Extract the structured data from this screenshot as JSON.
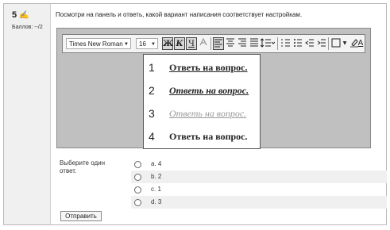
{
  "question": {
    "number": "5",
    "flag_glyph": "✍",
    "grade": "Баллов: --/2",
    "text": "Посмотри на панель и ответь, какой вариант написания соответствует настройкам."
  },
  "toolbar": {
    "font_name": "Times New Roman",
    "font_size": "16",
    "bold": "Ж",
    "italic": "К",
    "underline": "Ч",
    "style_a": "A",
    "dropdown_glyph": "▼"
  },
  "popup": {
    "options": [
      {
        "num": "1",
        "text": "Ответь на вопрос."
      },
      {
        "num": "2",
        "text": "Ответь на вопрос."
      },
      {
        "num": "3",
        "text": "Ответь на вопрос."
      },
      {
        "num": "4",
        "text": "Ответь на вопрос."
      }
    ]
  },
  "answers": {
    "prompt": "Выберите один ответ.",
    "items": [
      {
        "label": "a. 4"
      },
      {
        "label": "b. 2"
      },
      {
        "label": "c. 1"
      },
      {
        "label": "d. 3"
      }
    ]
  },
  "submit_label": "Отправить"
}
